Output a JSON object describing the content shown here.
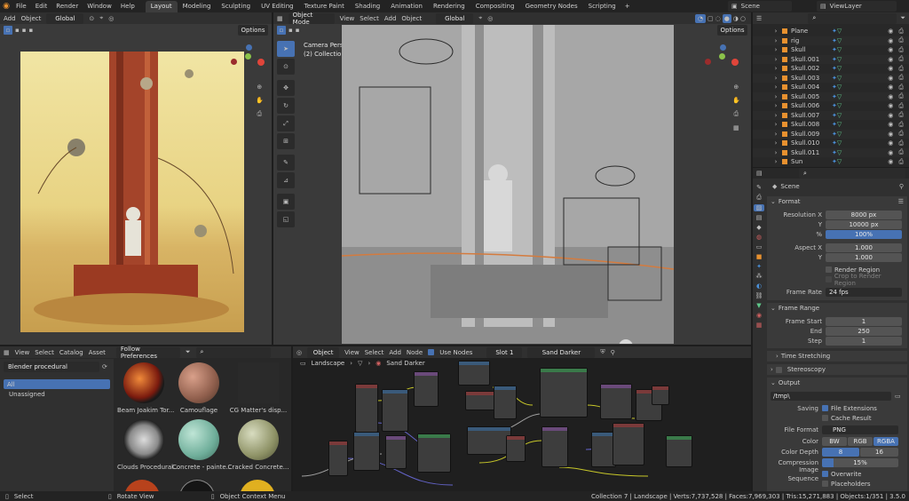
{
  "menu": {
    "items": [
      "File",
      "Edit",
      "Render",
      "Window",
      "Help"
    ],
    "workspaces": [
      "Layout",
      "Modeling",
      "Sculpting",
      "UV Editing",
      "Texture Paint",
      "Shading",
      "Animation",
      "Rendering",
      "Compositing",
      "Geometry Nodes",
      "Scripting"
    ],
    "active_workspace": "Layout",
    "scene": "Scene",
    "view_layer": "ViewLayer",
    "add_icon": "+"
  },
  "left_viewport": {
    "add": "Add",
    "object": "Object",
    "transform": "Global",
    "options": "Options"
  },
  "center_viewport": {
    "mode": "Object Mode",
    "menus": [
      "View",
      "Select",
      "Add",
      "Object"
    ],
    "transform": "Global",
    "options": "Options",
    "info_line1": "Camera Perspective",
    "info_line2": "(2) Collection 7 | Landscape"
  },
  "outliner": {
    "rows": [
      "Plane",
      "rig",
      "Skull",
      "Skull.001",
      "Skull.002",
      "Skull.003",
      "Skull.004",
      "Skull.005",
      "Skull.006",
      "Skull.007",
      "Skull.008",
      "Skull.009",
      "Skull.010",
      "Skull.011",
      "Sun"
    ]
  },
  "properties": {
    "scene_label": "Scene",
    "format": {
      "title": "Format",
      "res_x_label": "Resolution X",
      "res_x": "8000 px",
      "res_y_label": "Y",
      "res_y": "10000 px",
      "pct_label": "%",
      "pct": "100%",
      "aspect_x_label": "Aspect X",
      "aspect_x": "1.000",
      "aspect_y_label": "Y",
      "aspect_y": "1.000",
      "render_region": "Render Region",
      "crop_region": "Crop to Render Region",
      "frame_rate_label": "Frame Rate",
      "frame_rate": "24 fps"
    },
    "frame_range": {
      "title": "Frame Range",
      "start_label": "Frame Start",
      "start": "1",
      "end_label": "End",
      "end": "250",
      "step_label": "Step",
      "step": "1"
    },
    "time_stretching": "Time Stretching",
    "stereoscopy": "Stereoscopy",
    "output": {
      "title": "Output",
      "path": "/tmp\\",
      "saving_label": "Saving",
      "file_ext": "File Extensions",
      "cache_result": "Cache Result",
      "file_format_label": "File Format",
      "file_format": "PNG",
      "color_label": "Color",
      "color_opts": [
        "BW",
        "RGB",
        "RGBA"
      ],
      "color_active": "RGBA",
      "depth_label": "Color Depth",
      "depth_opts": [
        "8",
        "16"
      ],
      "depth_active": "8",
      "compression_label": "Compression",
      "compression": "15%",
      "compression_level": 0.15,
      "image_seq_label": "Image Sequence",
      "overwrite": "Overwrite",
      "placeholders": "Placeholders"
    }
  },
  "asset_browser": {
    "menus": [
      "View",
      "Select",
      "Catalog",
      "Asset"
    ],
    "import": "Follow Preferences",
    "library": "Blender procedural",
    "catalog_all": "All",
    "catalog_unassigned": "Unassigned",
    "assets": [
      "Beam Joakim Tor...",
      "Camouflage",
      "CG Matter's disp...",
      "Clouds Procedural...",
      "Concrete - painte...",
      "Cracked Concrete..."
    ]
  },
  "node_editor": {
    "type": "Object",
    "menus": [
      "View",
      "Select",
      "Add",
      "Node"
    ],
    "use_nodes": "Use Nodes",
    "slot": "Slot 1",
    "material": "Sand Darker",
    "breadcrumb_obj": "Landscape",
    "breadcrumb_mat": "Sand Darker"
  },
  "status_bar": {
    "select": "Select",
    "rotate": "Rotate View",
    "context": "Object Context Menu",
    "stats": "Collection 7 | Landscape | Verts:7,737,528 | Faces:7,969,303 | Tris:15,271,883 | Objects:1/351 | 3.5.0"
  },
  "colors": {
    "accent": "#4772b3",
    "orange": "#e8912f",
    "bg": "#1d1d1d",
    "panel": "#303030"
  }
}
